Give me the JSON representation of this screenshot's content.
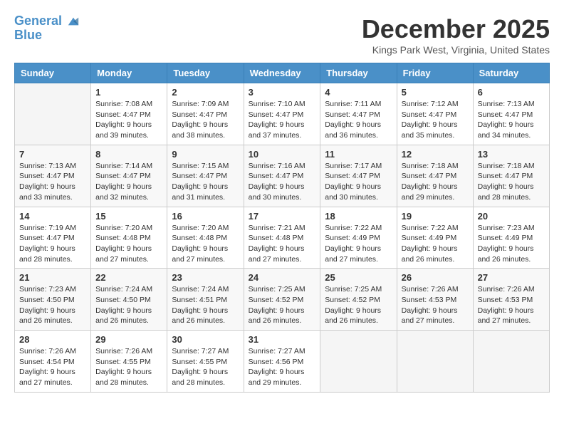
{
  "header": {
    "logo_line1": "General",
    "logo_line2": "Blue",
    "month_title": "December 2025",
    "location": "Kings Park West, Virginia, United States"
  },
  "days_of_week": [
    "Sunday",
    "Monday",
    "Tuesday",
    "Wednesday",
    "Thursday",
    "Friday",
    "Saturday"
  ],
  "weeks": [
    [
      {
        "day": "",
        "info": ""
      },
      {
        "day": "1",
        "info": "Sunrise: 7:08 AM\nSunset: 4:47 PM\nDaylight: 9 hours\nand 39 minutes."
      },
      {
        "day": "2",
        "info": "Sunrise: 7:09 AM\nSunset: 4:47 PM\nDaylight: 9 hours\nand 38 minutes."
      },
      {
        "day": "3",
        "info": "Sunrise: 7:10 AM\nSunset: 4:47 PM\nDaylight: 9 hours\nand 37 minutes."
      },
      {
        "day": "4",
        "info": "Sunrise: 7:11 AM\nSunset: 4:47 PM\nDaylight: 9 hours\nand 36 minutes."
      },
      {
        "day": "5",
        "info": "Sunrise: 7:12 AM\nSunset: 4:47 PM\nDaylight: 9 hours\nand 35 minutes."
      },
      {
        "day": "6",
        "info": "Sunrise: 7:13 AM\nSunset: 4:47 PM\nDaylight: 9 hours\nand 34 minutes."
      }
    ],
    [
      {
        "day": "7",
        "info": "Sunrise: 7:13 AM\nSunset: 4:47 PM\nDaylight: 9 hours\nand 33 minutes."
      },
      {
        "day": "8",
        "info": "Sunrise: 7:14 AM\nSunset: 4:47 PM\nDaylight: 9 hours\nand 32 minutes."
      },
      {
        "day": "9",
        "info": "Sunrise: 7:15 AM\nSunset: 4:47 PM\nDaylight: 9 hours\nand 31 minutes."
      },
      {
        "day": "10",
        "info": "Sunrise: 7:16 AM\nSunset: 4:47 PM\nDaylight: 9 hours\nand 30 minutes."
      },
      {
        "day": "11",
        "info": "Sunrise: 7:17 AM\nSunset: 4:47 PM\nDaylight: 9 hours\nand 30 minutes."
      },
      {
        "day": "12",
        "info": "Sunrise: 7:18 AM\nSunset: 4:47 PM\nDaylight: 9 hours\nand 29 minutes."
      },
      {
        "day": "13",
        "info": "Sunrise: 7:18 AM\nSunset: 4:47 PM\nDaylight: 9 hours\nand 28 minutes."
      }
    ],
    [
      {
        "day": "14",
        "info": "Sunrise: 7:19 AM\nSunset: 4:47 PM\nDaylight: 9 hours\nand 28 minutes."
      },
      {
        "day": "15",
        "info": "Sunrise: 7:20 AM\nSunset: 4:48 PM\nDaylight: 9 hours\nand 27 minutes."
      },
      {
        "day": "16",
        "info": "Sunrise: 7:20 AM\nSunset: 4:48 PM\nDaylight: 9 hours\nand 27 minutes."
      },
      {
        "day": "17",
        "info": "Sunrise: 7:21 AM\nSunset: 4:48 PM\nDaylight: 9 hours\nand 27 minutes."
      },
      {
        "day": "18",
        "info": "Sunrise: 7:22 AM\nSunset: 4:49 PM\nDaylight: 9 hours\nand 27 minutes."
      },
      {
        "day": "19",
        "info": "Sunrise: 7:22 AM\nSunset: 4:49 PM\nDaylight: 9 hours\nand 26 minutes."
      },
      {
        "day": "20",
        "info": "Sunrise: 7:23 AM\nSunset: 4:49 PM\nDaylight: 9 hours\nand 26 minutes."
      }
    ],
    [
      {
        "day": "21",
        "info": "Sunrise: 7:23 AM\nSunset: 4:50 PM\nDaylight: 9 hours\nand 26 minutes."
      },
      {
        "day": "22",
        "info": "Sunrise: 7:24 AM\nSunset: 4:50 PM\nDaylight: 9 hours\nand 26 minutes."
      },
      {
        "day": "23",
        "info": "Sunrise: 7:24 AM\nSunset: 4:51 PM\nDaylight: 9 hours\nand 26 minutes."
      },
      {
        "day": "24",
        "info": "Sunrise: 7:25 AM\nSunset: 4:52 PM\nDaylight: 9 hours\nand 26 minutes."
      },
      {
        "day": "25",
        "info": "Sunrise: 7:25 AM\nSunset: 4:52 PM\nDaylight: 9 hours\nand 26 minutes."
      },
      {
        "day": "26",
        "info": "Sunrise: 7:26 AM\nSunset: 4:53 PM\nDaylight: 9 hours\nand 27 minutes."
      },
      {
        "day": "27",
        "info": "Sunrise: 7:26 AM\nSunset: 4:53 PM\nDaylight: 9 hours\nand 27 minutes."
      }
    ],
    [
      {
        "day": "28",
        "info": "Sunrise: 7:26 AM\nSunset: 4:54 PM\nDaylight: 9 hours\nand 27 minutes."
      },
      {
        "day": "29",
        "info": "Sunrise: 7:26 AM\nSunset: 4:55 PM\nDaylight: 9 hours\nand 28 minutes."
      },
      {
        "day": "30",
        "info": "Sunrise: 7:27 AM\nSunset: 4:55 PM\nDaylight: 9 hours\nand 28 minutes."
      },
      {
        "day": "31",
        "info": "Sunrise: 7:27 AM\nSunset: 4:56 PM\nDaylight: 9 hours\nand 29 minutes."
      },
      {
        "day": "",
        "info": ""
      },
      {
        "day": "",
        "info": ""
      },
      {
        "day": "",
        "info": ""
      }
    ]
  ]
}
